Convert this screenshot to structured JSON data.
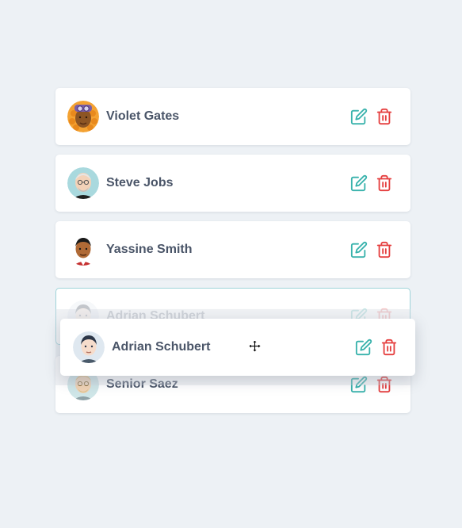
{
  "list": {
    "items": [
      {
        "name": "Violet Gates",
        "avatar_icon": "avatar-violet-icon"
      },
      {
        "name": "Steve Jobs",
        "avatar_icon": "avatar-steve-icon"
      },
      {
        "name": "Yassine Smith",
        "avatar_icon": "avatar-yassine-icon"
      },
      {
        "name": "Adrian Schubert",
        "avatar_icon": "avatar-adrian-icon",
        "state": "placeholder"
      },
      {
        "name": "Senior Saez",
        "avatar_icon": "avatar-senior-icon"
      }
    ],
    "dragging_item": {
      "name": "Adrian Schubert",
      "avatar_icon": "avatar-adrian-icon"
    }
  },
  "icons": {
    "edit": "edit-icon",
    "delete": "trash-icon",
    "cursor": "move-cursor-icon"
  },
  "colors": {
    "background": "#edf1f5",
    "card": "#ffffff",
    "name_text": "#4a5568",
    "edit": "#38b2ac",
    "delete": "#e53e3e",
    "placeholder_border": "#9ed3d9"
  }
}
